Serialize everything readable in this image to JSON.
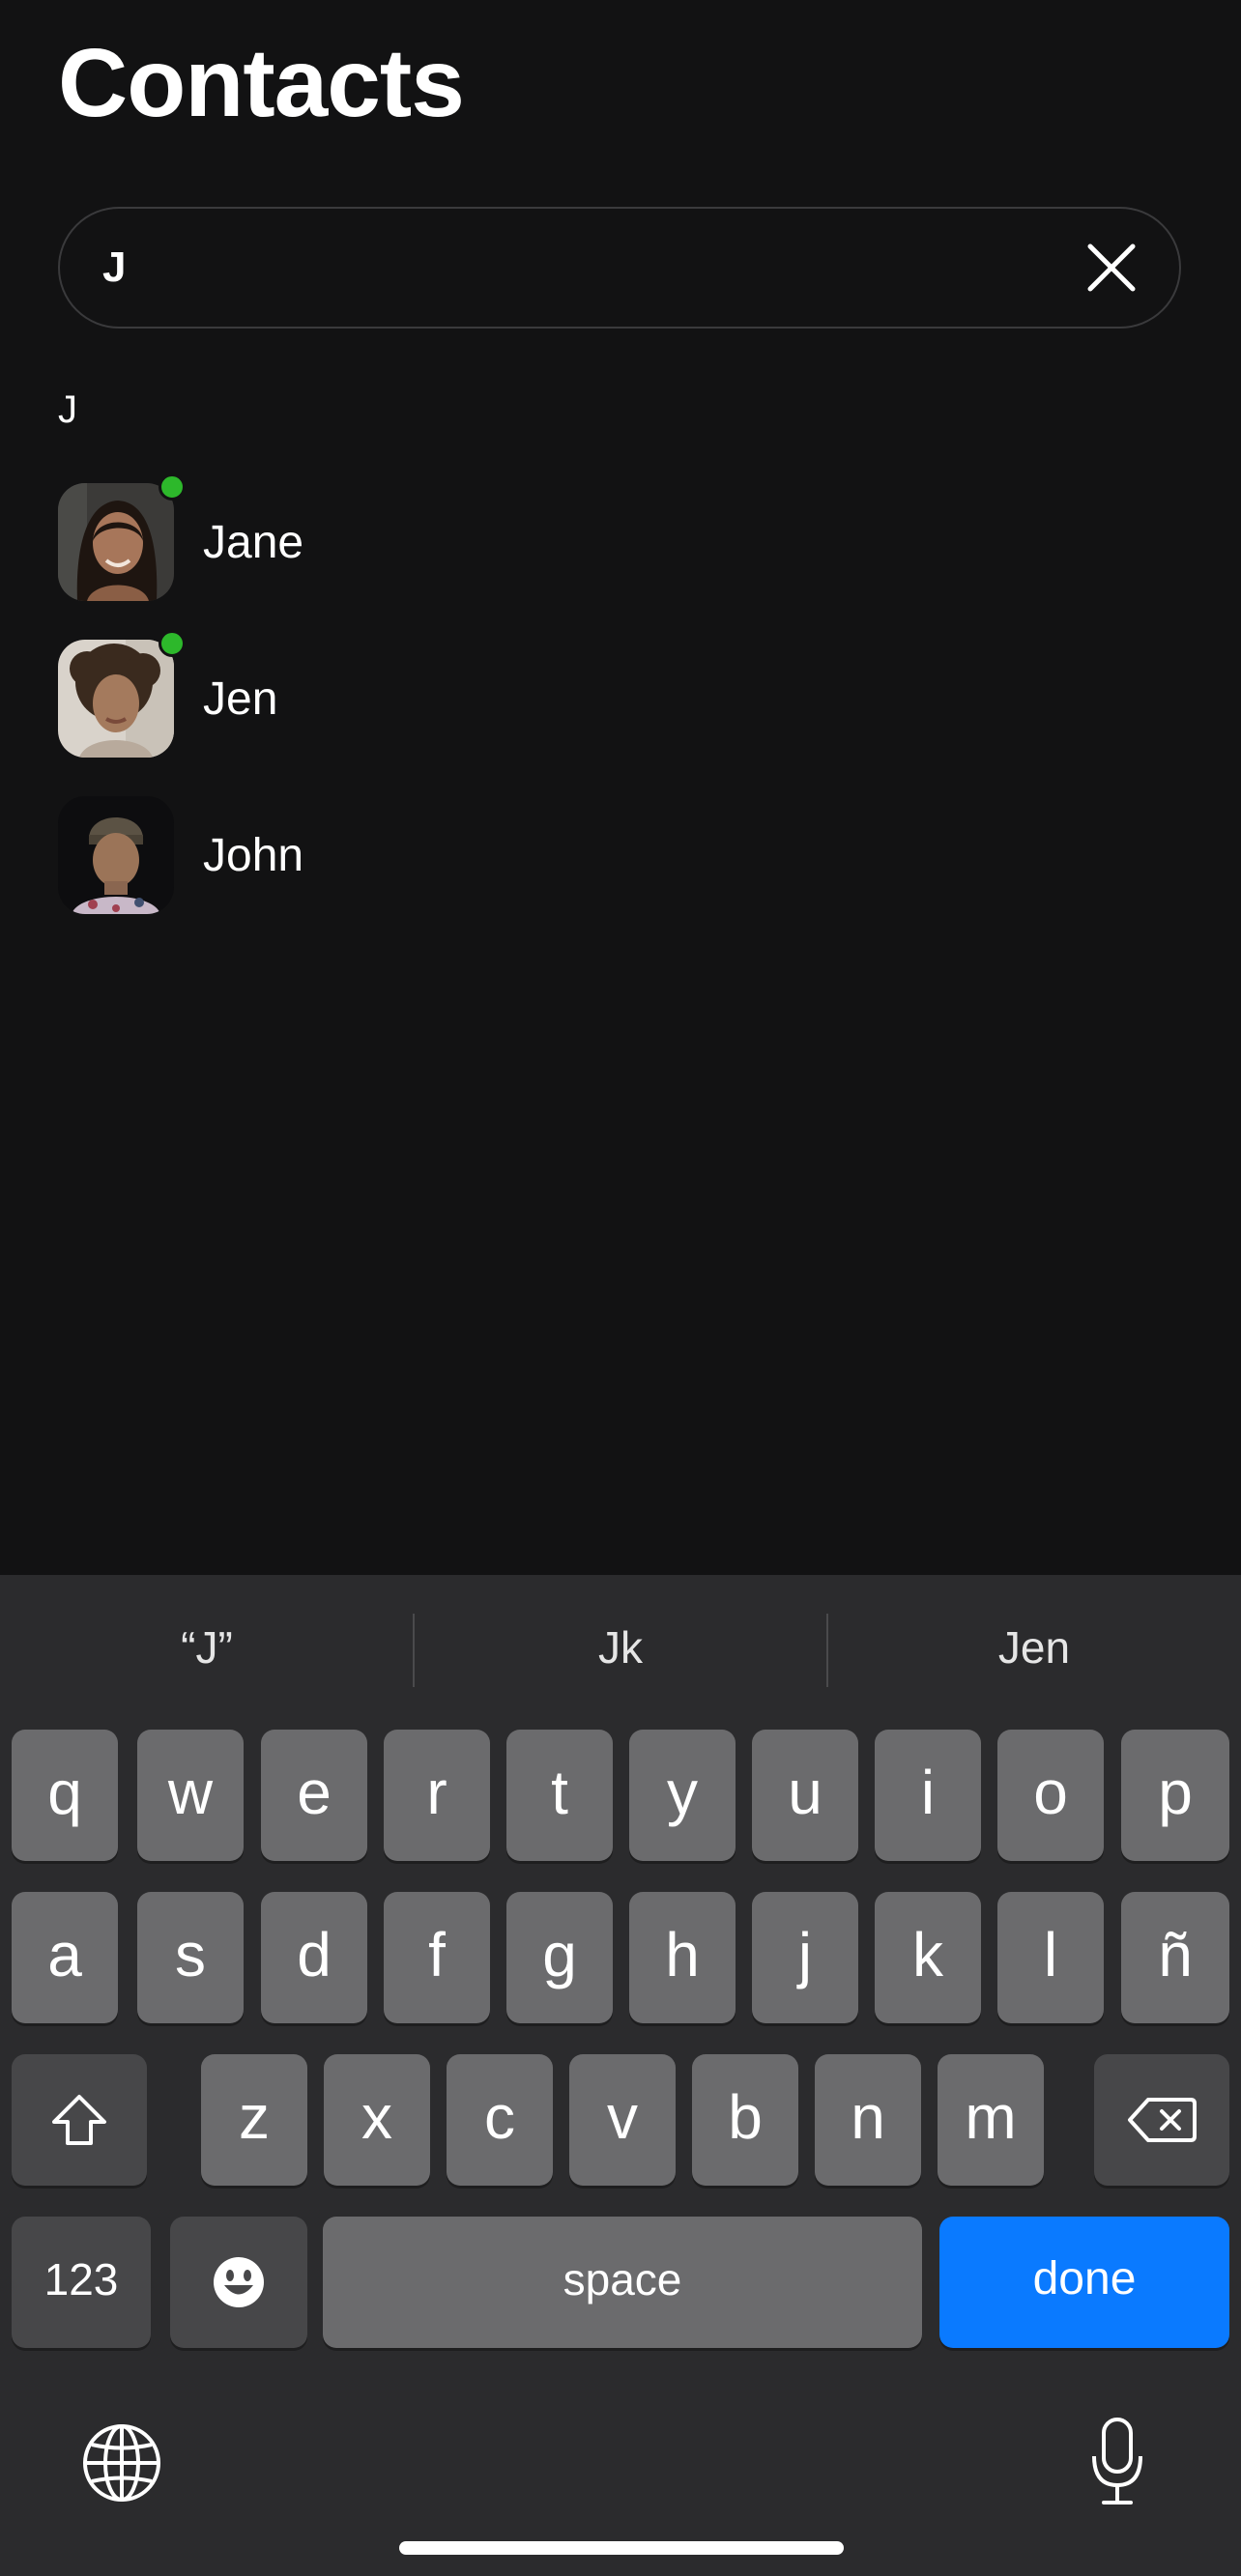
{
  "header": {
    "title": "Contacts"
  },
  "search": {
    "value": "J",
    "placeholder": ""
  },
  "section_letter": "J",
  "contacts": [
    {
      "name": "Jane",
      "online": true
    },
    {
      "name": "Jen",
      "online": true
    },
    {
      "name": "John",
      "online": false
    }
  ],
  "keyboard": {
    "suggestions": [
      "“J”",
      "Jk",
      "Jen"
    ],
    "row1": [
      "q",
      "w",
      "e",
      "r",
      "t",
      "y",
      "u",
      "i",
      "o",
      "p"
    ],
    "row2": [
      "a",
      "s",
      "d",
      "f",
      "g",
      "h",
      "j",
      "k",
      "l",
      "ñ"
    ],
    "row3": [
      "z",
      "x",
      "c",
      "v",
      "b",
      "n",
      "m"
    ],
    "numbers_label": "123",
    "space_label": "space",
    "done_label": "done"
  },
  "colors": {
    "accent": "#0a7aff",
    "online": "#2db82b",
    "background": "#121213"
  }
}
